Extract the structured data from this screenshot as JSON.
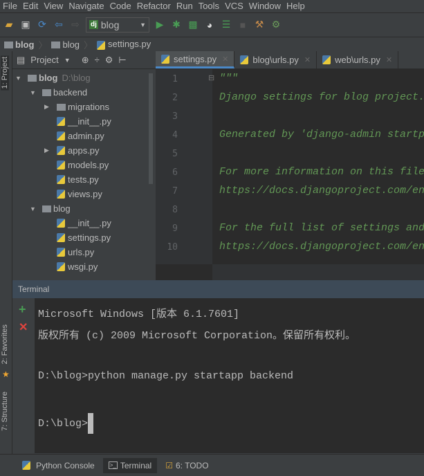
{
  "menu": [
    "File",
    "Edit",
    "View",
    "Navigate",
    "Code",
    "Refactor",
    "Run",
    "Tools",
    "VCS",
    "Window",
    "Help"
  ],
  "toolbar": {
    "run_config": "blog",
    "run_config_badge": "dj"
  },
  "breadcrumb": [
    "blog",
    "blog",
    "settings.py"
  ],
  "left_stripe": {
    "project": "1: Project",
    "favorites": "2: Favorites",
    "structure": "7: Structure"
  },
  "project_panel": {
    "title": "Project"
  },
  "tree": [
    {
      "label": "blog",
      "hint": "D:\\blog",
      "type": "folder",
      "depth": 0,
      "expanded": true
    },
    {
      "label": "backend",
      "type": "folder",
      "depth": 1,
      "expanded": true
    },
    {
      "label": "migrations",
      "type": "folder",
      "depth": 2,
      "expanded": false
    },
    {
      "label": "__init__.py",
      "type": "py",
      "depth": 2
    },
    {
      "label": "admin.py",
      "type": "py",
      "depth": 2
    },
    {
      "label": "apps.py",
      "type": "py",
      "depth": 2,
      "expanded": false
    },
    {
      "label": "models.py",
      "type": "py",
      "depth": 2
    },
    {
      "label": "tests.py",
      "type": "py",
      "depth": 2
    },
    {
      "label": "views.py",
      "type": "py",
      "depth": 2
    },
    {
      "label": "blog",
      "type": "folder",
      "depth": 1,
      "expanded": true
    },
    {
      "label": "__init__.py",
      "type": "py",
      "depth": 2
    },
    {
      "label": "settings.py",
      "type": "py",
      "depth": 2
    },
    {
      "label": "urls.py",
      "type": "py",
      "depth": 2
    },
    {
      "label": "wsgi.py",
      "type": "py",
      "depth": 2
    }
  ],
  "tabs": [
    {
      "label": "settings.py",
      "active": true
    },
    {
      "label": "blog\\urls.py"
    },
    {
      "label": "web\\urls.py"
    }
  ],
  "code_lines": [
    "\"\"\"",
    "Django settings for blog project.",
    "",
    "Generated by 'django-admin startp",
    "",
    "For more information on this file",
    "https://docs.djangoproject.com/en",
    "",
    "For the full list of settings and",
    "https://docs.djangoproject.com/en"
  ],
  "terminal": {
    "title": "Terminal",
    "lines": [
      "Microsoft Windows [版本 6.1.7601]",
      "版权所有 (c) 2009 Microsoft Corporation。保留所有权利。",
      "",
      "D:\\blog>python manage.py startapp backend",
      "",
      "D:\\blog>"
    ]
  },
  "bottom_tabs": [
    {
      "label": "Python Console"
    },
    {
      "label": "Terminal",
      "active": true
    },
    {
      "label": "6: TODO"
    }
  ]
}
